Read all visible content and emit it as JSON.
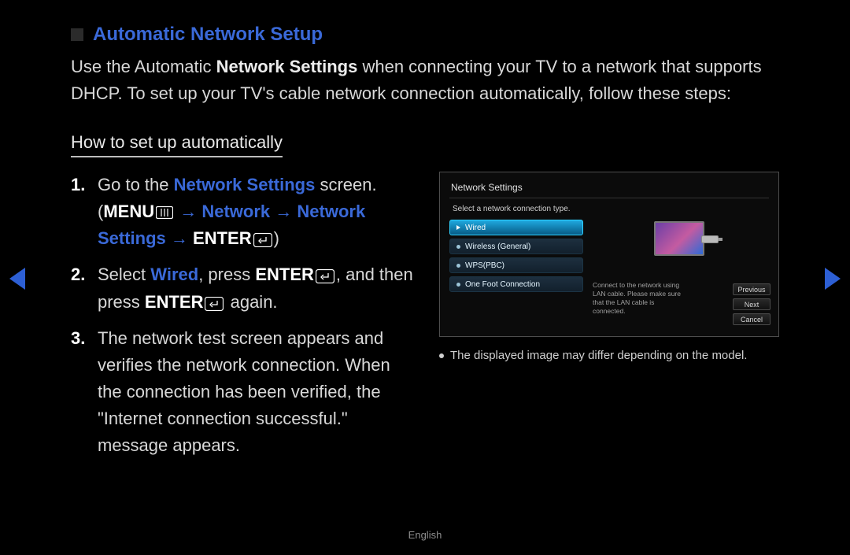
{
  "title": "Automatic Network Setup",
  "intro": {
    "pre": "Use the Automatic ",
    "bold": "Network Settings",
    "post": " when connecting your TV to a network that supports DHCP. To set up your TV's cable network connection automatically, follow these steps:"
  },
  "subheading": "How to set up automatically",
  "steps": {
    "s1": {
      "a": "Go to the ",
      "b": "Network Settings",
      "c": " screen.",
      "menu": "MENU",
      "p1": "Network",
      "p2": "Network Settings",
      "enter": "ENTER"
    },
    "s2": {
      "a": "Select ",
      "wired": "Wired",
      "b": ", press ",
      "enter1": "ENTER",
      "c": ", and then press ",
      "enter2": "ENTER",
      "d": " again."
    },
    "s3": "The network test screen appears and verifies the network connection. When the connection has been verified, the \"Internet connection successful.\" message appears."
  },
  "window": {
    "title": "Network Settings",
    "instruction": "Select a network connection type.",
    "options": [
      "Wired",
      "Wireless (General)",
      "WPS(PBC)",
      "One Foot Connection"
    ],
    "tip": "Connect to the network using LAN cable. Please make sure that the LAN cable is connected.",
    "buttons": [
      "Previous",
      "Next",
      "Cancel"
    ]
  },
  "note": "The displayed image may differ depending on the model.",
  "footer": "English"
}
